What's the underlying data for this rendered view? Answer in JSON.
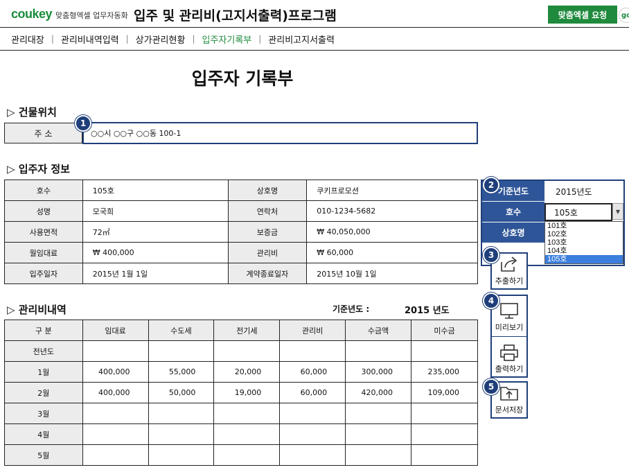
{
  "header": {
    "logo": "coukey",
    "logo_sub": "맞춤형엑셀 업무자동화",
    "app_title": "입주 및 관리비(고지서출력)프로그램",
    "request_button": "맞춤엑셀 요청",
    "go_badge": "go"
  },
  "nav": {
    "items": [
      "관리대장",
      "관리비내역입력",
      "상가관리현황",
      "입주자기록부",
      "관리비고지서출력"
    ],
    "separator": "|"
  },
  "page_title": "입주자 기록부",
  "building": {
    "section_title": "▷ 건물위치",
    "address_label": "주 소",
    "address_value": "○○시 ○○구 ○○동 100-1"
  },
  "tenant": {
    "section_title": "▷ 입주자 정보",
    "rows": [
      {
        "l1": "호수",
        "v1": "105호",
        "l2": "상호명",
        "v2": "쿠키프로모션"
      },
      {
        "l1": "성명",
        "v1": "모국희",
        "l2": "연락처",
        "v2": "010-1234-5682"
      },
      {
        "l1": "사용면적",
        "v1": "72㎡",
        "l2": "보증금",
        "v2": "₩ 40,050,000"
      },
      {
        "l1": "월임대료",
        "v1": "₩ 400,000",
        "l2": "관리비",
        "v2": "₩ 60,000"
      },
      {
        "l1": "입주일자",
        "v1": "2015년 1월 1일",
        "l2": "계약종료일자",
        "v2": "2015년 10월 1일"
      }
    ]
  },
  "fees": {
    "section_title": "▷ 관리비내역",
    "year_label": "기준년도 :",
    "year_value": "2015 년도",
    "headers": [
      "구  분",
      "임대료",
      "수도세",
      "전기세",
      "관리비",
      "수금액",
      "미수금"
    ],
    "rows": [
      {
        "label": "전년도",
        "values": [
          "",
          "",
          "",
          "",
          "",
          ""
        ]
      },
      {
        "label": "1월",
        "values": [
          "400,000",
          "55,000",
          "20,000",
          "60,000",
          "300,000",
          "235,000"
        ]
      },
      {
        "label": "2월",
        "values": [
          "400,000",
          "50,000",
          "19,000",
          "60,000",
          "420,000",
          "109,000"
        ]
      },
      {
        "label": "3월",
        "values": [
          "",
          "",
          "",
          "",
          "",
          ""
        ]
      },
      {
        "label": "4월",
        "values": [
          "",
          "",
          "",
          "",
          "",
          ""
        ]
      },
      {
        "label": "5월",
        "values": [
          "",
          "",
          "",
          "",
          "",
          ""
        ]
      }
    ]
  },
  "side_panel": {
    "year_label": "기준년도",
    "year_value": "2015년도",
    "unit_label": "호수",
    "unit_value": "105호",
    "shop_label": "상호명",
    "unit_options": [
      "101호",
      "102호",
      "103호",
      "104호",
      "105호"
    ],
    "selected_index": 4
  },
  "actions": {
    "export": "추출하기",
    "preview": "미리보기",
    "print": "출력하기",
    "save": "문서저장"
  },
  "markers": [
    "1",
    "2",
    "3",
    "4",
    "5"
  ]
}
